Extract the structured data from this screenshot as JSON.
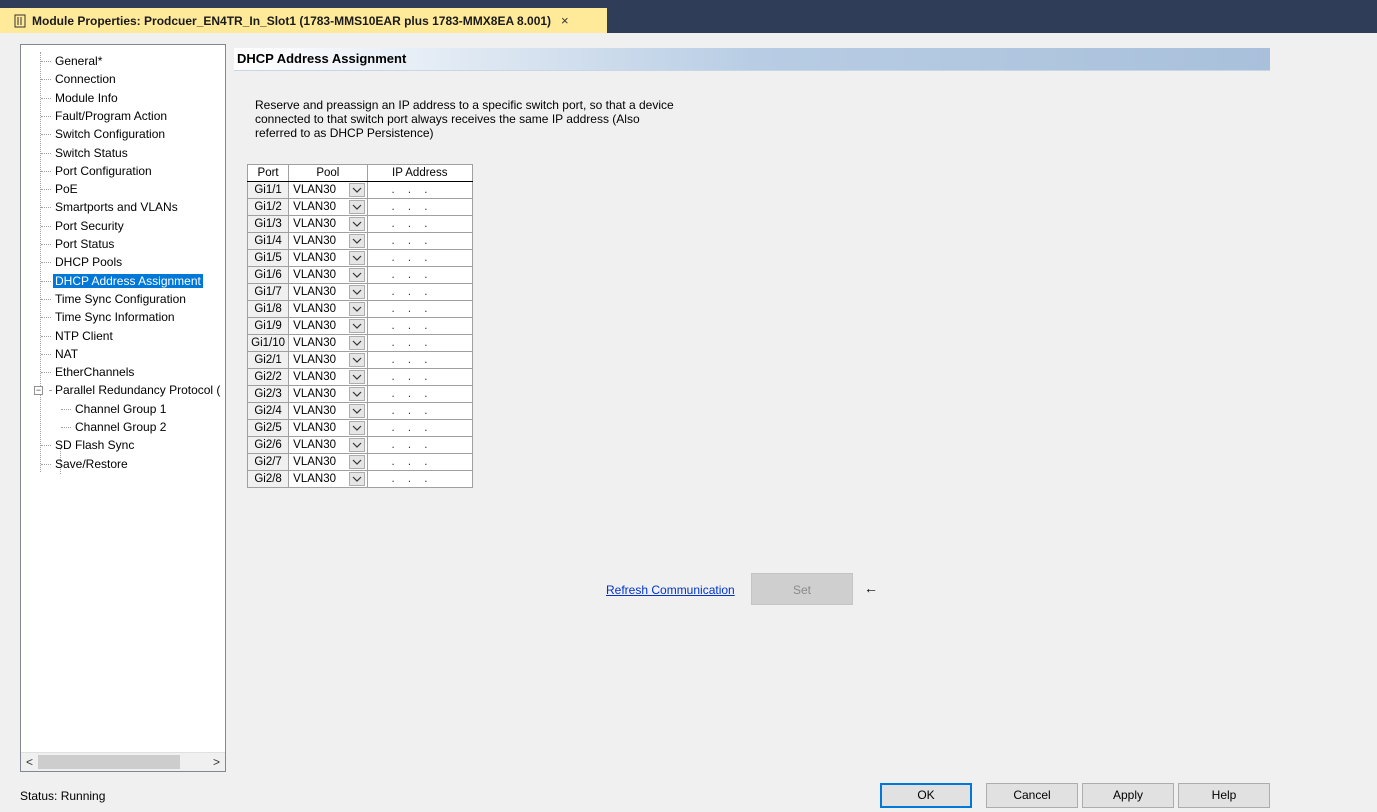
{
  "window": {
    "title": "Module Properties: Prodcuer_EN4TR_In_Slot1 (1783-MMS10EAR plus 1783-MMX8EA 8.001)",
    "close_glyph": "×"
  },
  "tree": {
    "items": [
      {
        "label": "General*"
      },
      {
        "label": "Connection"
      },
      {
        "label": "Module Info"
      },
      {
        "label": "Fault/Program Action"
      },
      {
        "label": "Switch Configuration"
      },
      {
        "label": "Switch Status"
      },
      {
        "label": "Port Configuration"
      },
      {
        "label": "PoE"
      },
      {
        "label": "Smartports and VLANs"
      },
      {
        "label": "Port Security"
      },
      {
        "label": "Port Status"
      },
      {
        "label": "DHCP Pools"
      },
      {
        "label": "DHCP Address Assignment",
        "selected": true
      },
      {
        "label": "Time Sync Configuration"
      },
      {
        "label": "Time Sync Information"
      },
      {
        "label": "NTP Client"
      },
      {
        "label": "NAT"
      },
      {
        "label": "EtherChannels"
      },
      {
        "label": "Parallel Redundancy Protocol (",
        "expandable": true
      },
      {
        "label": "Channel Group 1",
        "child": true
      },
      {
        "label": "Channel Group 2",
        "child": true
      },
      {
        "label": "SD Flash Sync"
      },
      {
        "label": "Save/Restore"
      }
    ],
    "expander_glyph": "−",
    "scroll_left": "<",
    "scroll_right": ">"
  },
  "section": {
    "title": "DHCP Address Assignment",
    "description": "Reserve and preassign an IP address to a specific switch port, so that a device connected to that switch port always receives the same IP address (Also referred to as DHCP Persistence)"
  },
  "table": {
    "headers": [
      "Port",
      "Pool",
      "IP Address"
    ],
    "rows": [
      {
        "port": "Gi1/1",
        "pool": "VLAN30",
        "ip": ". . ."
      },
      {
        "port": "Gi1/2",
        "pool": "VLAN30",
        "ip": ". . ."
      },
      {
        "port": "Gi1/3",
        "pool": "VLAN30",
        "ip": ". . ."
      },
      {
        "port": "Gi1/4",
        "pool": "VLAN30",
        "ip": ". . ."
      },
      {
        "port": "Gi1/5",
        "pool": "VLAN30",
        "ip": ". . ."
      },
      {
        "port": "Gi1/6",
        "pool": "VLAN30",
        "ip": ". . ."
      },
      {
        "port": "Gi1/7",
        "pool": "VLAN30",
        "ip": ". . ."
      },
      {
        "port": "Gi1/8",
        "pool": "VLAN30",
        "ip": ". . ."
      },
      {
        "port": "Gi1/9",
        "pool": "VLAN30",
        "ip": ". . ."
      },
      {
        "port": "Gi1/10",
        "pool": "VLAN30",
        "ip": ". . ."
      },
      {
        "port": "Gi2/1",
        "pool": "VLAN30",
        "ip": ". . ."
      },
      {
        "port": "Gi2/2",
        "pool": "VLAN30",
        "ip": ". . ."
      },
      {
        "port": "Gi2/3",
        "pool": "VLAN30",
        "ip": ". . ."
      },
      {
        "port": "Gi2/4",
        "pool": "VLAN30",
        "ip": ". . ."
      },
      {
        "port": "Gi2/5",
        "pool": "VLAN30",
        "ip": ". . ."
      },
      {
        "port": "Gi2/6",
        "pool": "VLAN30",
        "ip": ". . ."
      },
      {
        "port": "Gi2/7",
        "pool": "VLAN30",
        "ip": ". . ."
      },
      {
        "port": "Gi2/8",
        "pool": "VLAN30",
        "ip": ". . ."
      }
    ]
  },
  "actions": {
    "refresh_link": "Refresh Communication",
    "set_button": "Set",
    "arrow": "←"
  },
  "status": {
    "text": "Status:  Running"
  },
  "buttons": {
    "ok": "OK",
    "cancel": "Cancel",
    "apply": "Apply",
    "help": "Help"
  },
  "colors": {
    "title_bar_bg": "#2f3d58",
    "tab_bg": "#ffea9a",
    "selection": "#0078d7",
    "link": "#0033cc"
  }
}
